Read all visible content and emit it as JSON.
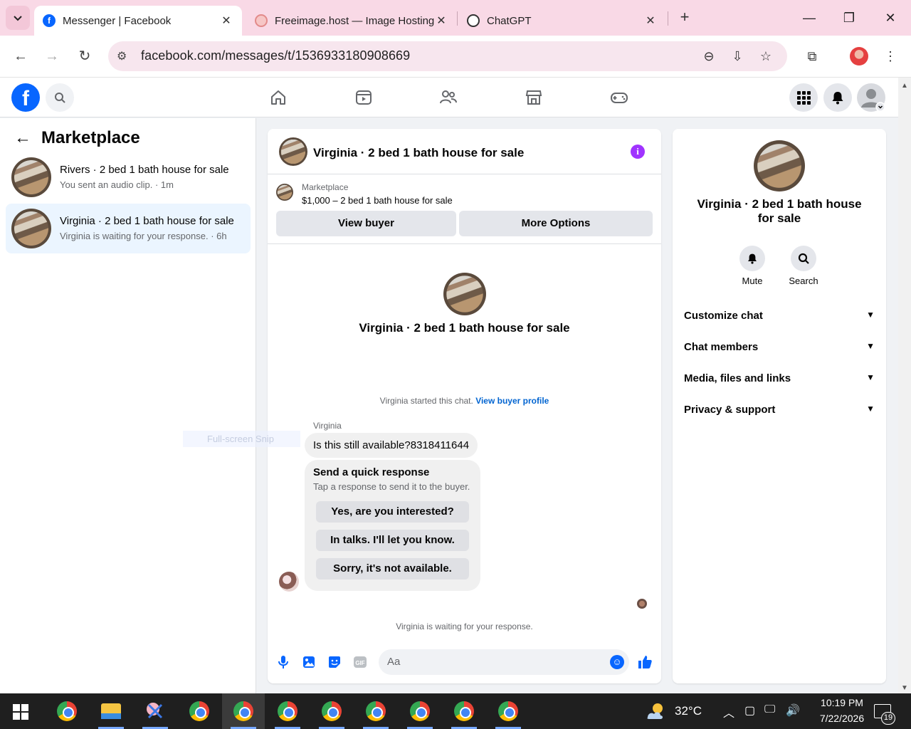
{
  "browser": {
    "tabs": [
      {
        "title": "Messenger | Facebook",
        "favicon": "facebook-icon",
        "active": true
      },
      {
        "title": "Freeimage.host — Image Hosting",
        "favicon": "freeimage-icon",
        "active": false
      },
      {
        "title": "ChatGPT",
        "favicon": "chatgpt-icon",
        "active": false
      }
    ],
    "url": "facebook.com/messages/t/1536933180908669",
    "colors": {
      "tabstrip": "#f9d9e6",
      "omnibox": "#f7e6ee"
    }
  },
  "facebook": {
    "brand_color": "#0866ff",
    "logo_letter": "f",
    "nav_items": [
      "home-icon",
      "video-icon",
      "friends-icon",
      "marketplace-icon",
      "gaming-icon"
    ]
  },
  "left_panel": {
    "title": "Marketplace",
    "conversations": [
      {
        "name": "Rivers · 2 bed 1 bath house for sale",
        "subtitle": "You sent an audio clip. · 1m",
        "active": false
      },
      {
        "name": "Virginia · 2 bed 1 bath house for sale",
        "subtitle": "Virginia is waiting for your response. · 6h",
        "active": true
      }
    ]
  },
  "chat": {
    "title": "Virginia · 2 bed 1 bath house for sale",
    "marketplace_label": "Marketplace",
    "listing": "$1,000 – 2 bed 1 bath house for sale",
    "view_buyer_label": "View buyer",
    "more_options_label": "More Options",
    "intro_title": "Virginia · 2 bed 1 bath house for sale",
    "started_text": "Virginia started this chat.",
    "buyer_profile_link": "View buyer profile",
    "sender": "Virginia",
    "message": "Is this still available?8318411644",
    "quick_response": {
      "title": "Send a quick response",
      "subtitle": "Tap a response to send it to the buyer.",
      "options": [
        "Yes, are you interested?",
        "In talks. I'll let you know.",
        "Sorry, it's not available."
      ]
    },
    "waiting_text": "Virginia is waiting for your response.",
    "composer_placeholder": "Aa",
    "accent_color": "#a033ff"
  },
  "right_panel": {
    "title": "Virginia · 2 bed 1 bath house for sale",
    "actions": [
      {
        "label": "Mute",
        "icon": "bell-icon"
      },
      {
        "label": "Search",
        "icon": "search-icon"
      }
    ],
    "sections": [
      "Customize chat",
      "Chat members",
      "Media, files and links",
      "Privacy & support"
    ]
  },
  "overlay": {
    "ghost_text": "Full-screen Snip"
  },
  "taskbar": {
    "temperature": "32°C",
    "time": "10:19 PM",
    "date": "7/22/2026",
    "notification_count": "19"
  }
}
